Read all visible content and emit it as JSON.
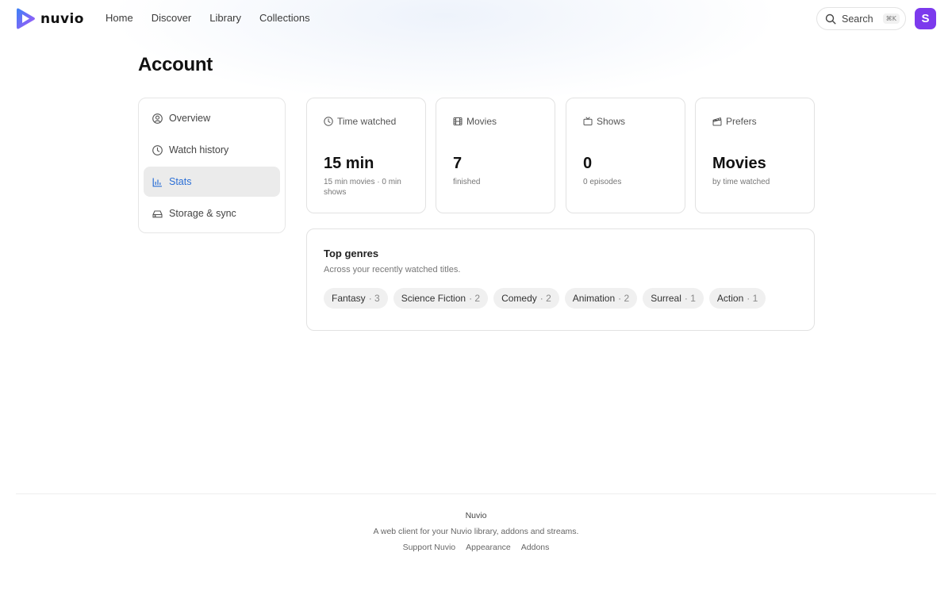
{
  "brand": {
    "name": "nuvio",
    "colors": {
      "accent": "#2b6fd6",
      "avatar": "#7c3aed",
      "logo_from": "#3b82f6",
      "logo_to": "#a855f7"
    }
  },
  "nav": {
    "items": [
      "Home",
      "Discover",
      "Library",
      "Collections"
    ]
  },
  "search": {
    "label": "Search",
    "shortcut": "⌘K",
    "icon": "search-icon"
  },
  "user": {
    "initial": "S"
  },
  "page": {
    "title": "Account"
  },
  "sidebar": {
    "items": [
      {
        "label": "Overview",
        "icon": "user-circle-icon",
        "active": false
      },
      {
        "label": "Watch history",
        "icon": "clock-icon",
        "active": false
      },
      {
        "label": "Stats",
        "icon": "bar-chart-icon",
        "active": true
      },
      {
        "label": "Storage & sync",
        "icon": "hard-drive-icon",
        "active": false
      }
    ]
  },
  "stats": {
    "cards": [
      {
        "label": "Time watched",
        "icon": "clock-icon",
        "value": "15 min",
        "sub": "15 min movies · 0 min shows"
      },
      {
        "label": "Movies",
        "icon": "film-icon",
        "value": "7",
        "sub": "finished"
      },
      {
        "label": "Shows",
        "icon": "tv-icon",
        "value": "0",
        "sub": "0 episodes"
      },
      {
        "label": "Prefers",
        "icon": "clapperboard-icon",
        "value": "Movies",
        "sub": "by time watched"
      }
    ]
  },
  "genres": {
    "title": "Top genres",
    "subtitle": "Across your recently watched titles.",
    "items": [
      {
        "name": "Fantasy",
        "count": "· 3"
      },
      {
        "name": "Science Fiction",
        "count": "· 2"
      },
      {
        "name": "Comedy",
        "count": "· 2"
      },
      {
        "name": "Animation",
        "count": "· 2"
      },
      {
        "name": "Surreal",
        "count": "· 1"
      },
      {
        "name": "Action",
        "count": "· 1"
      }
    ]
  },
  "footer": {
    "brand": "Nuvio",
    "tagline": "A web client for your Nuvio library, addons and streams.",
    "links": [
      "Support Nuvio",
      "Appearance",
      "Addons"
    ]
  }
}
